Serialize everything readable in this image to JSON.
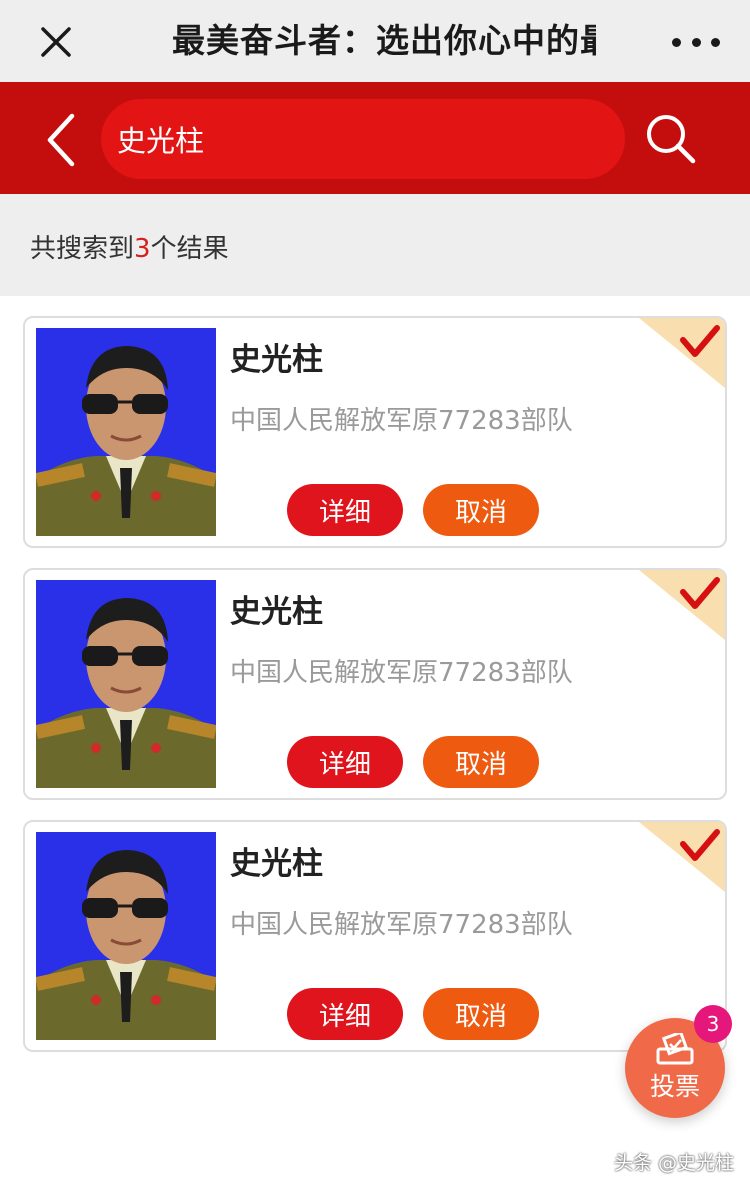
{
  "topbar": {
    "title": "最美奋斗者：选出你心中的最",
    "close_icon": "close-icon",
    "more_icon": "more-dots-icon"
  },
  "search": {
    "value": "史光柱",
    "back_icon": "chevron-left-icon",
    "search_icon": "search-icon"
  },
  "results": {
    "prefix": "共搜索到",
    "count": "3",
    "suffix": "个结果"
  },
  "cards": [
    {
      "name": "史光柱",
      "unit": "中国人民解放军原77283部队",
      "detail_label": "详细",
      "cancel_label": "取消",
      "selected": true
    },
    {
      "name": "史光柱",
      "unit": "中国人民解放军原77283部队",
      "detail_label": "详细",
      "cancel_label": "取消",
      "selected": true
    },
    {
      "name": "史光柱",
      "unit": "中国人民解放军原77283部队",
      "detail_label": "详细",
      "cancel_label": "取消",
      "selected": true
    }
  ],
  "vote": {
    "label": "投票",
    "badge": "3",
    "icon": "ballot-box-icon"
  },
  "watermark": "头条 @史光柱",
  "colors": {
    "header_red": "#c40e0e",
    "search_red": "#e31414",
    "detail_red": "#e0141c",
    "cancel_orange": "#ee5a10",
    "badge_pink": "#e6177a",
    "photo_blue": "#2a2fe8"
  }
}
